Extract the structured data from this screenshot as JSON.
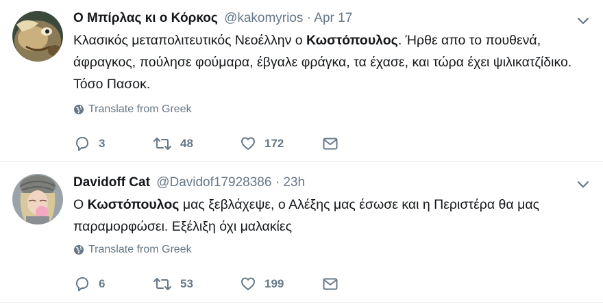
{
  "tweets": [
    {
      "name": "Ο Μπίρλας κι ο Κόρκος",
      "handle": "@kakomyrios",
      "separator": "·",
      "time": "Apr 17",
      "text_before": "Κλασικός μεταπολιτευτικός Νεοέλλην ο ",
      "text_bold": "Κωστόπουλος",
      "text_after": ". Ήρθε απο το πουθενά, άφραγκος, πούλησε φούμαρα, έβγαλε φράγκα, τα έχασε, και τώρα έχει ψιλικατζίδικο. Τόσο Πασοκ.",
      "translate_label": "Translate from Greek",
      "replies": "3",
      "retweets": "48",
      "likes": "172",
      "avatar_icon": "cartoon-avatar-icon"
    },
    {
      "name": "Davidoff Cat",
      "handle": "@Davidof17928386",
      "separator": "·",
      "time": "23h",
      "text_before": "Ο ",
      "text_bold": "Κωστόπουλος",
      "text_after": " μας ξεβλάχεψε, ο Αλέξης μας έσωσε και η Περιστέρα θα μας παραμορφώσει. Εξέλιξη όχι μαλακίες",
      "translate_label": "Translate from Greek",
      "replies": "6",
      "retweets": "53",
      "likes": "199",
      "avatar_icon": "woman-bubblegum-avatar-icon"
    }
  ],
  "colors": {
    "text": "#14171a",
    "muted": "#657786",
    "divider": "#e6ecf0"
  }
}
